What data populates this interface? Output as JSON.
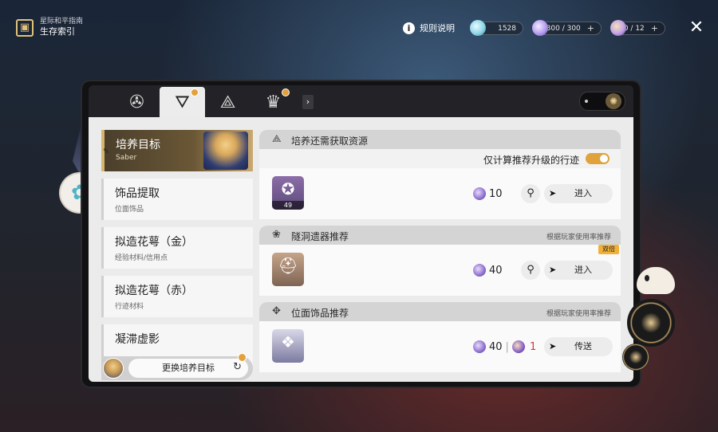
{
  "topbar": {
    "brand_line1": "星际和平指南",
    "brand_line2": "生存索引",
    "rules_label": "规则说明",
    "currencies": [
      {
        "name": "stellar-jade",
        "value": "1528",
        "color": "#8fd6e8"
      },
      {
        "name": "trailblaze-power",
        "value": "300 / 300",
        "color": "#b59cf0"
      },
      {
        "name": "fuel",
        "value": "0 / 12",
        "color": "#c3a0e8"
      }
    ]
  },
  "tabs": [
    {
      "icon": "wheel-icon",
      "glyph": "✇",
      "active": false,
      "badge": false
    },
    {
      "icon": "target-tracker-icon",
      "glyph": "⛛",
      "active": true,
      "badge": true
    },
    {
      "icon": "shield-triangle-icon",
      "glyph": "⟁",
      "active": false,
      "badge": false
    },
    {
      "icon": "crest-icon",
      "glyph": "♛",
      "active": false,
      "badge": true
    }
  ],
  "left_list": {
    "target": {
      "title": "培养目标",
      "subtitle": "Saber"
    },
    "items": [
      {
        "title": "饰品提取",
        "subtitle": "位面饰品"
      },
      {
        "title": "拟造花萼（金）",
        "subtitle": "经验材料/信用点"
      },
      {
        "title": "拟造花萼（赤）",
        "subtitle": "行迹材料"
      },
      {
        "title": "凝滞虚影",
        "subtitle": ""
      }
    ],
    "swap_label": "更换培养目标"
  },
  "sections": {
    "resources": {
      "title": "培养还需获取资源",
      "filter_label": "仅计算推荐升级的行迹",
      "filter_on": true,
      "row": {
        "item_count": "49",
        "cost": "10",
        "go_label": "进入"
      }
    },
    "relics": {
      "title": "隧洞遗器推荐",
      "hint": "根据玩家使用率推荐",
      "tag": "双倍",
      "row": {
        "cost": "40",
        "go_label": "进入"
      }
    },
    "planar": {
      "title": "位面饰品推荐",
      "hint": "根据玩家使用率推荐",
      "row": {
        "cost": "40",
        "cost2": "1",
        "go_label": "传送"
      }
    }
  }
}
